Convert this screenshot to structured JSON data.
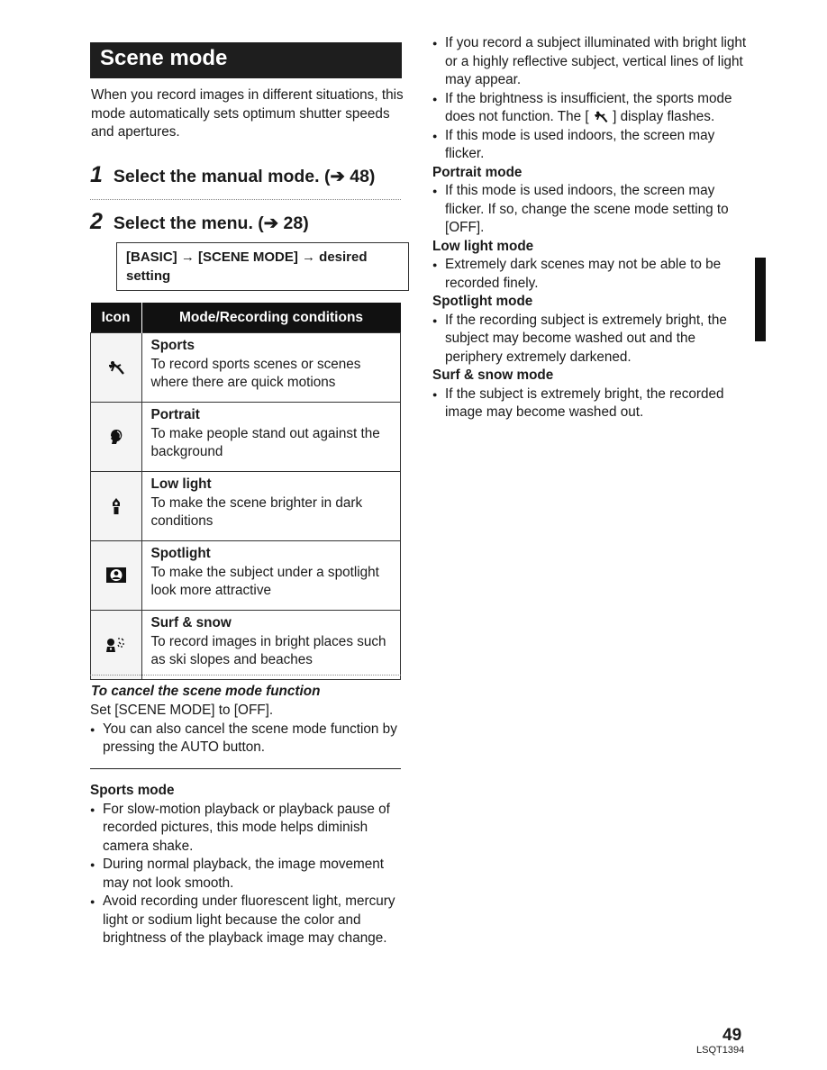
{
  "page": {
    "title": "Scene mode",
    "intro": "When you record images in different situations, this mode automatically sets optimum shutter speeds and apertures.",
    "steps": [
      {
        "number": "1",
        "text": "Select the manual mode. (➔ 48)"
      },
      {
        "number": "2",
        "text": "Select the menu. (➔ 28)"
      }
    ],
    "menu_path": "[BASIC] → [SCENE MODE] → desired setting",
    "table": {
      "headers": [
        "Icon",
        "Mode/Recording conditions"
      ],
      "rows": [
        {
          "icon": "sports-icon",
          "name": "Sports",
          "desc": "To record sports scenes or scenes where there are quick motions"
        },
        {
          "icon": "portrait-icon",
          "name": "Portrait",
          "desc": "To make people stand out against the background"
        },
        {
          "icon": "low-light-icon",
          "name": "Low light",
          "desc": "To make the scene brighter in dark conditions"
        },
        {
          "icon": "spotlight-icon",
          "name": "Spotlight",
          "desc": "To make the subject under a spotlight look more attractive"
        },
        {
          "icon": "surf-snow-icon",
          "name": "Surf & snow",
          "desc": "To record images in bright places such as ski slopes and beaches"
        }
      ]
    },
    "cancel": {
      "heading": "To cancel the scene mode function",
      "text": "Set [SCENE MODE] to [OFF].",
      "bullet": "You can also cancel the scene mode function by pressing the AUTO button."
    },
    "notes": {
      "sports": {
        "heading": "Sports mode",
        "bullets": [
          "For slow-motion playback or playback pause of recorded pictures, this mode helps diminish camera shake.",
          "During normal playback, the image movement may not look smooth.",
          "Avoid recording under fluorescent light, mercury light or sodium light because the color and brightness of the playback image may change.",
          "If you record a subject illuminated with bright light or a highly reflective subject, vertical lines of light may appear."
        ],
        "flash_bullet_before": "If the brightness is insufficient, the sports mode does not function. The [",
        "flash_bullet_after": "] display flashes.",
        "last_bullet": "If this mode is used indoors, the screen may flicker."
      },
      "portrait": {
        "heading": "Portrait mode",
        "bullets": [
          "If this mode is used indoors, the screen may flicker. If so, change the scene mode setting to [OFF]."
        ]
      },
      "low_light": {
        "heading": "Low light mode",
        "bullets": [
          "Extremely dark scenes may not be able to be recorded finely."
        ]
      },
      "spotlight": {
        "heading": "Spotlight mode",
        "bullets": [
          "If the recording subject is extremely bright, the subject may become washed out and the periphery extremely darkened."
        ]
      },
      "surf_snow": {
        "heading": "Surf & snow mode",
        "bullets": [
          "If the subject is extremely bright, the recorded image may become washed out."
        ]
      }
    },
    "page_number": "49",
    "doc_code": "LSQT1394"
  }
}
